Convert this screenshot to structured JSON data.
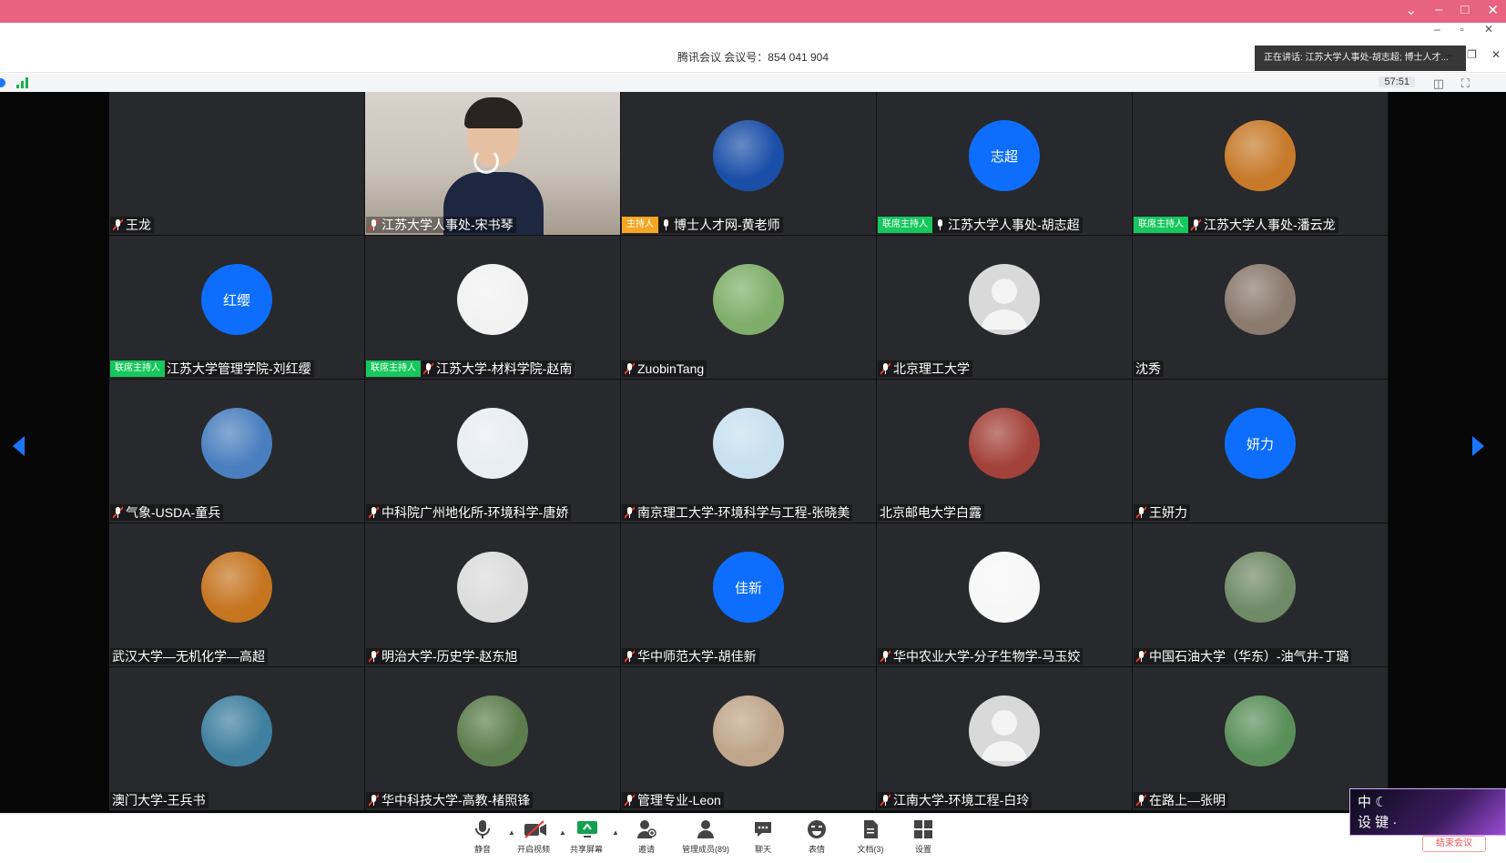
{
  "window": {
    "title": "腾讯会议 会议号：854 041 904",
    "timer": "57:51"
  },
  "speaking": {
    "text": "正在讲话: 江苏大学人事处-胡志超; 博士人才..."
  },
  "participants": [
    {
      "name": "王龙",
      "badge": "",
      "mic": "muted",
      "avatar": {
        "type": "none"
      }
    },
    {
      "name": "江苏大学人事处-宋书琴",
      "badge": "",
      "mic": "muted",
      "avatar": {
        "type": "camera"
      }
    },
    {
      "name": "博士人才网-黄老师",
      "badge": "主持人",
      "badge_type": "host",
      "mic": "on",
      "avatar": {
        "type": "img",
        "icon": "graduation-cap-logo-icon",
        "bg": "#1a4fa8"
      }
    },
    {
      "name": "江苏大学人事处-胡志超",
      "badge": "联席主持人",
      "badge_type": "cohost",
      "mic": "on",
      "avatar": {
        "type": "text",
        "text": "志超"
      }
    },
    {
      "name": "江苏大学人事处-潘云龙",
      "badge": "联席主持人",
      "badge_type": "cohost",
      "mic": "muted",
      "avatar": {
        "type": "img",
        "icon": "autumn-photo-icon",
        "bg": "#c77a2a"
      }
    },
    {
      "name": "江苏大学管理学院-刘红缨",
      "badge": "联席主持人",
      "badge_type": "cohost",
      "mic": "",
      "avatar": {
        "type": "text",
        "text": "红缨"
      }
    },
    {
      "name": "江苏大学-材料学院-赵南",
      "badge": "联席主持人",
      "badge_type": "cohost",
      "mic": "muted",
      "avatar": {
        "type": "img",
        "icon": "rooster-icon",
        "bg": "#f2f2f2"
      }
    },
    {
      "name": "ZuobinTang",
      "badge": "",
      "mic": "muted",
      "avatar": {
        "type": "img",
        "icon": "child-photo-icon",
        "bg": "#7fae6a"
      }
    },
    {
      "name": "北京理工大学",
      "badge": "",
      "mic": "muted",
      "avatar": {
        "type": "default"
      }
    },
    {
      "name": "沈秀",
      "badge": "",
      "mic": "",
      "avatar": {
        "type": "img",
        "icon": "travel-photo-icon",
        "bg": "#8b7a6e"
      }
    },
    {
      "name": "气象-USDA-童兵",
      "badge": "",
      "mic": "muted",
      "avatar": {
        "type": "img",
        "icon": "beach-photo-icon",
        "bg": "#4a7fbf"
      }
    },
    {
      "name": "中科院广州地化所-环境科学-唐娇",
      "badge": "",
      "mic": "muted",
      "avatar": {
        "type": "img",
        "icon": "cartoon-boy-icon",
        "bg": "#e9eef5"
      }
    },
    {
      "name": "南京理工大学-环境科学与工程-张晓美",
      "badge": "",
      "mic": "muted",
      "avatar": {
        "type": "img",
        "icon": "cartoon-girl-icon",
        "bg": "#c9e0f0"
      }
    },
    {
      "name": "北京邮电大学白露",
      "badge": "",
      "mic": "",
      "avatar": {
        "type": "img",
        "icon": "baby-red-hat-icon",
        "bg": "#a3423a"
      }
    },
    {
      "name": "王妍力",
      "badge": "",
      "mic": "muted",
      "avatar": {
        "type": "text",
        "text": "妍力"
      }
    },
    {
      "name": "武汉大学—无机化学—高超",
      "badge": "",
      "mic": "",
      "avatar": {
        "type": "img",
        "icon": "clock-autumn-icon",
        "bg": "#c5741f"
      }
    },
    {
      "name": "明治大学-历史学-赵东旭",
      "badge": "",
      "mic": "muted",
      "avatar": {
        "type": "img",
        "icon": "portrait-man-icon",
        "bg": "#dcdcdc"
      }
    },
    {
      "name": "华中师范大学-胡佳新",
      "badge": "",
      "mic": "muted",
      "avatar": {
        "type": "text",
        "text": "佳新"
      }
    },
    {
      "name": "华中农业大学-分子生物学-马玉姣",
      "badge": "",
      "mic": "muted",
      "avatar": {
        "type": "img",
        "icon": "cartoon-lemon-icon",
        "bg": "#f7f7f7"
      }
    },
    {
      "name": "中国石油大学（华东）-油气井-丁璐",
      "badge": "",
      "mic": "muted",
      "avatar": {
        "type": "img",
        "icon": "outdoor-photo-icon",
        "bg": "#6f8a66"
      }
    },
    {
      "name": "澳门大学-王兵书",
      "badge": "",
      "mic": "",
      "avatar": {
        "type": "img",
        "icon": "tennis-photo-icon",
        "bg": "#3f7f9f"
      }
    },
    {
      "name": "华中科技大学-高教-楮照锋",
      "badge": "",
      "mic": "muted",
      "avatar": {
        "type": "img",
        "icon": "tree-photo-icon",
        "bg": "#5c7d4d"
      }
    },
    {
      "name": "管理专业-Leon",
      "badge": "",
      "mic": "muted",
      "avatar": {
        "type": "img",
        "icon": "baby-ball-icon",
        "bg": "#bfa68a"
      }
    },
    {
      "name": "江南大学-环境工程-白玲",
      "badge": "",
      "mic": "muted",
      "avatar": {
        "type": "default"
      }
    },
    {
      "name": "在路上—张明",
      "badge": "",
      "mic": "muted",
      "avatar": {
        "type": "img",
        "icon": "landscape-photo-icon",
        "bg": "#5a8f5a"
      }
    }
  ],
  "toolbar": {
    "mute": "静音",
    "video": "开启视频",
    "share": "共享屏幕",
    "invite": "邀请",
    "members": "管理成员(89)",
    "chat": "聊天",
    "emoji": "表情",
    "docs": "文档(3)",
    "settings": "设置"
  },
  "corner": {
    "line1": "中 ☾",
    "line2": "设 键 ·",
    "end_meeting": "结束会议"
  },
  "colors": {
    "outer_bar": "#e8637f",
    "accent_blue": "#1b76ff",
    "host_badge": "#f5a623",
    "cohost_badge": "#16c75b"
  }
}
